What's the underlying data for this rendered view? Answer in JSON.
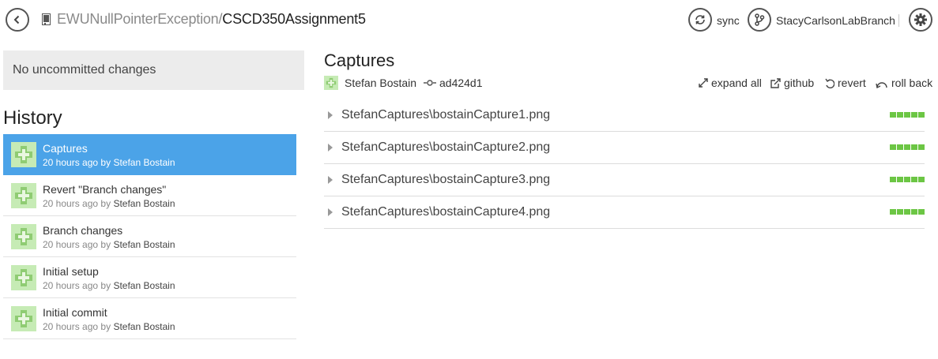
{
  "header": {
    "repo_owner": "EWUNullPointerException",
    "separator": "/",
    "repo_name": "CSCD350Assignment5",
    "sync_label": "sync",
    "branch_label": "StacyCarlsonLabBranch"
  },
  "icons": {
    "back": "back-arrow-icon",
    "repo": "repo-book-icon",
    "sync": "sync-icon",
    "branch": "branch-icon",
    "settings": "gear-icon",
    "commit": "commit-icon",
    "expand": "expand-icon",
    "github": "external-link-icon",
    "revert": "revert-icon",
    "rollback": "rollback-icon"
  },
  "colors": {
    "selected": "#4ba3e8",
    "avatar_light": "#c6ebb5",
    "avatar_dark": "#8fcc73",
    "diff_added": "#6cc644"
  },
  "sidebar": {
    "uncommitted_text": "No uncommitted changes",
    "history_title": "History",
    "commits": [
      {
        "title": "Captures",
        "time": "20 hours ago",
        "by": "by",
        "author": "Stefan Bostain",
        "selected": true
      },
      {
        "title": "Revert \"Branch changes\"",
        "time": "20 hours ago",
        "by": "by",
        "author": "Stefan Bostain",
        "selected": false
      },
      {
        "title": "Branch changes",
        "time": "20 hours ago",
        "by": "by",
        "author": "Stefan Bostain",
        "selected": false
      },
      {
        "title": "Initial setup",
        "time": "20 hours ago",
        "by": "by",
        "author": "Stefan Bostain",
        "selected": false
      },
      {
        "title": "Initial commit",
        "time": "20 hours ago",
        "by": "by",
        "author": "Stefan Bostain",
        "selected": false
      }
    ]
  },
  "detail": {
    "title": "Captures",
    "author": "Stefan Bostain",
    "sha": "ad424d1",
    "actions": {
      "expand_all": "expand all",
      "github": "github",
      "revert": "revert",
      "roll_back": "roll back"
    },
    "files": [
      {
        "name": "StefanCaptures\\bostainCapture1.png",
        "added_blocks": 5
      },
      {
        "name": "StefanCaptures\\bostainCapture2.png",
        "added_blocks": 5
      },
      {
        "name": "StefanCaptures\\bostainCapture3.png",
        "added_blocks": 5
      },
      {
        "name": "StefanCaptures\\bostainCapture4.png",
        "added_blocks": 5
      }
    ]
  }
}
